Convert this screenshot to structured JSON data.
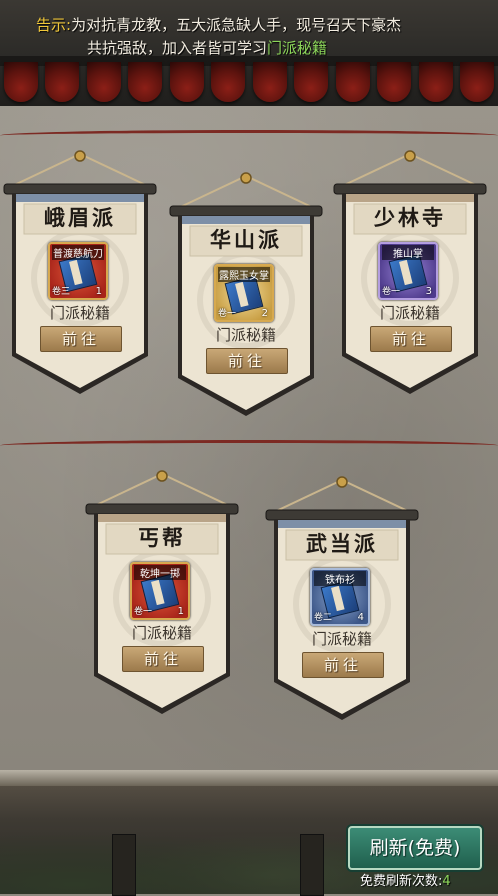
{
  "notice": {
    "tag": "告示:",
    "line1": "为对抗青龙教，五大派急缺人手，现号召天下豪杰",
    "line2_prefix": "共抗强敌，加入者皆可学习",
    "line2_highlight": "门派秘籍"
  },
  "sects": [
    {
      "name": "峨眉派",
      "book": "普渡慈航刀",
      "volume": "卷三",
      "level": "1",
      "label": "门派秘籍",
      "button": "前往",
      "book_color": "red",
      "frame": "#7d8fa7"
    },
    {
      "name": "华山派",
      "book": "露熙玉女掌",
      "volume": "卷一",
      "level": "2",
      "label": "门派秘籍",
      "button": "前往",
      "book_color": "gold",
      "frame": "#7d8fa7"
    },
    {
      "name": "少林寺",
      "book": "推山掌",
      "volume": "卷一",
      "level": "3",
      "label": "门派秘籍",
      "button": "前往",
      "book_color": "purple",
      "frame": "#b9a488"
    },
    {
      "name": "丐帮",
      "book": "乾坤一掷",
      "volume": "卷一",
      "level": "1",
      "label": "门派秘籍",
      "button": "前往",
      "book_color": "red",
      "frame": "#b9a488"
    },
    {
      "name": "武当派",
      "book": "铁布衫",
      "volume": "卷二",
      "level": "4",
      "label": "门派秘籍",
      "button": "前往",
      "book_color": "blue",
      "frame": "#7d8fa7"
    }
  ],
  "refresh": {
    "button": "刷新(免费)",
    "count_label": "免费刷新次数:",
    "count": "4"
  }
}
